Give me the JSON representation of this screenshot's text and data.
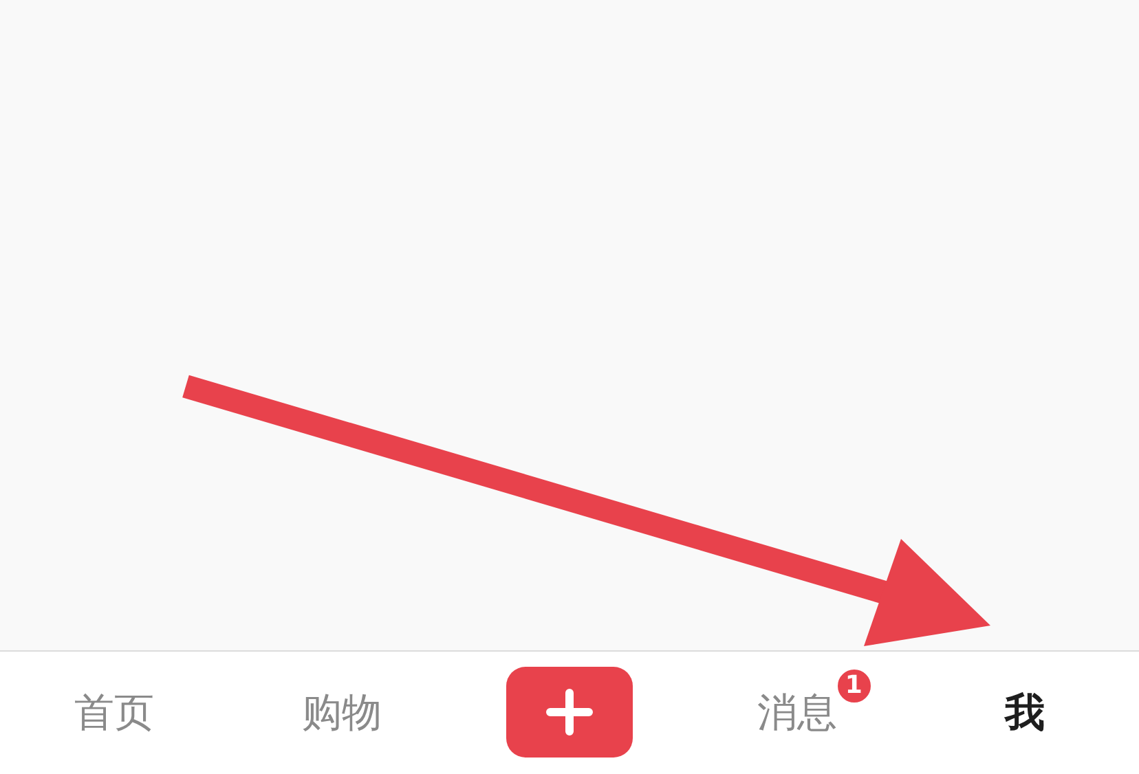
{
  "tab_bar": {
    "tabs": [
      {
        "kind": "tab",
        "label": "首页",
        "selected": false
      },
      {
        "kind": "tab",
        "label": "购物",
        "selected": false
      },
      {
        "kind": "add"
      },
      {
        "kind": "tab",
        "label": "消息",
        "selected": false,
        "badge": "1"
      },
      {
        "kind": "tab",
        "label": "我",
        "selected": true
      }
    ]
  }
}
